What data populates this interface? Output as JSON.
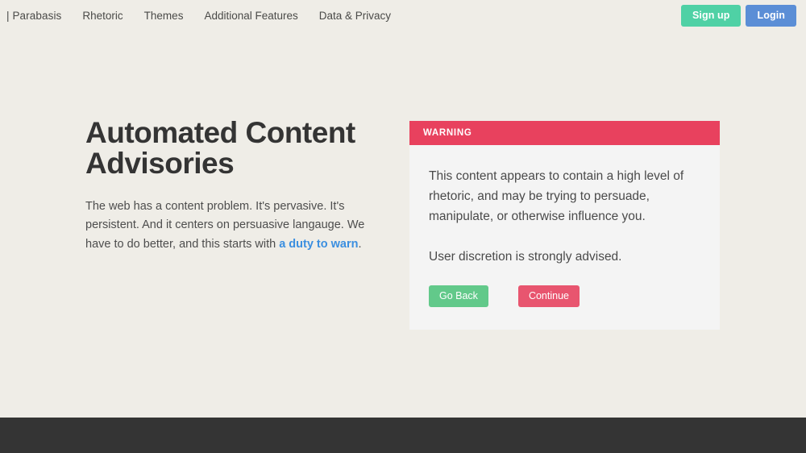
{
  "navbar": {
    "brand": "| Parabasis",
    "links": [
      {
        "label": "Rhetoric"
      },
      {
        "label": "Themes"
      },
      {
        "label": "Additional Features"
      },
      {
        "label": "Data & Privacy"
      }
    ],
    "signup_label": "Sign up",
    "login_label": "Login",
    "signup_color": "#4fd1a5",
    "login_color": "#5b8ed6"
  },
  "hero": {
    "title": "Automated Content Advisories",
    "paragraph_before": "The web has a content problem. It's pervasive. It's persistent. And it centers on persuasive langauge. We have to do better, and this starts with ",
    "link_label": "a duty to warn",
    "paragraph_after": ".",
    "link_color": "#3b8fe0"
  },
  "warning_card": {
    "header_label": "WARNING",
    "header_color": "#e8415e",
    "body_color": "#f4f4f4",
    "paragraph_1": "This content appears to contain a high level of rhetoric, and may be trying to persuade, manipulate, or otherwise influence you.",
    "paragraph_2": "User discretion is strongly advised.",
    "go_back_label": "Go Back",
    "continue_label": "Continue",
    "go_back_color": "#62c98a",
    "continue_color": "#e8556f"
  },
  "footer": {
    "background_color": "#343434"
  },
  "page": {
    "background_color": "#efede7"
  }
}
